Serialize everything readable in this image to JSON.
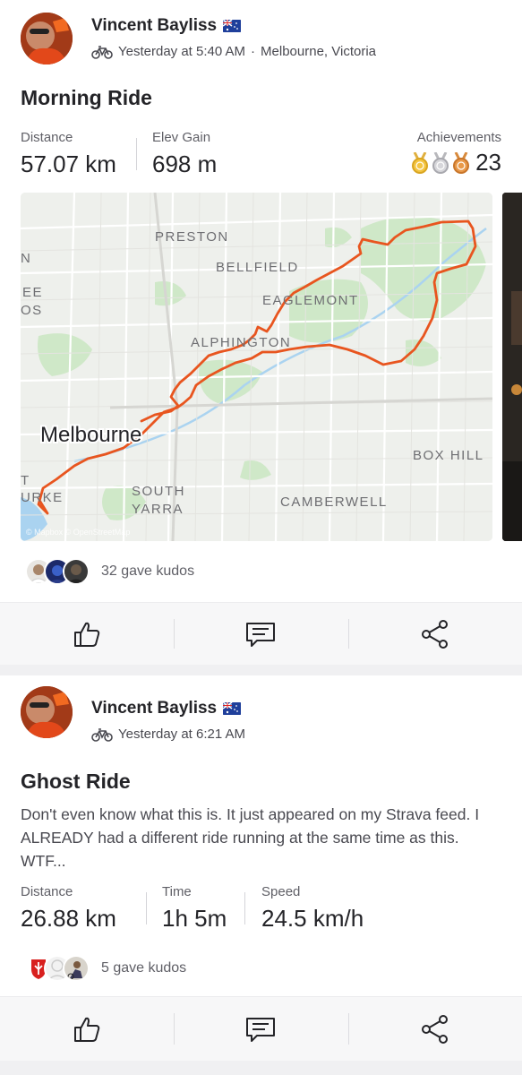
{
  "feed": [
    {
      "athlete": {
        "name": "Vincent Bayliss",
        "flag_icon": "australia-flag-icon"
      },
      "meta": {
        "activity_icon": "bike-icon",
        "time": "Yesterday at 5:40 AM",
        "separator": "·",
        "location": "Melbourne, Victoria"
      },
      "title": "Morning Ride",
      "stats": [
        {
          "label": "Distance",
          "value": "57.07 km"
        },
        {
          "label": "Elev Gain",
          "value": "698 m"
        }
      ],
      "achievements": {
        "label": "Achievements",
        "count": "23",
        "medals": [
          "gold",
          "silver",
          "bronze"
        ]
      },
      "map": {
        "labels": [
          "PRESTON",
          "BELLFIELD",
          "EAGLEMONT",
          "ALPHINGTON",
          "Melbourne",
          "SOUTH",
          "YARRA",
          "CAMBERWELL",
          "BOX HILL",
          "N",
          "EE",
          "OS",
          "T",
          "URKE"
        ],
        "attribution": "© Mapbox © OpenStreetMap",
        "route_color": "#e8551f"
      },
      "kudos": {
        "text": "32 gave kudos"
      },
      "actions": [
        {
          "name": "kudos",
          "icon": "thumbs-up-icon"
        },
        {
          "name": "comment",
          "icon": "comment-icon"
        },
        {
          "name": "share",
          "icon": "share-icon"
        }
      ]
    },
    {
      "athlete": {
        "name": "Vincent Bayliss",
        "flag_icon": "australia-flag-icon"
      },
      "meta": {
        "activity_icon": "bike-icon",
        "time": "Yesterday at 6:21 AM"
      },
      "title": "Ghost Ride",
      "description": "Don't even know what this is. It just appeared on my Strava feed. I ALREADY had a different ride running at the same time as this. WTF...",
      "stats": [
        {
          "label": "Distance",
          "value": "26.88 km"
        },
        {
          "label": "Time",
          "value": "1h 5m"
        },
        {
          "label": "Speed",
          "value": "24.5 km/h"
        }
      ],
      "kudos": {
        "text": "5 gave kudos"
      },
      "actions": [
        {
          "name": "kudos",
          "icon": "thumbs-up-icon"
        },
        {
          "name": "comment",
          "icon": "comment-icon"
        },
        {
          "name": "share",
          "icon": "share-icon"
        }
      ]
    }
  ],
  "colors": {
    "accent": "#fc4c02",
    "route": "#e8551f",
    "text": "#242428",
    "muted": "#5f5f66",
    "park": "#cfe8c8",
    "water": "#aad3f0"
  }
}
